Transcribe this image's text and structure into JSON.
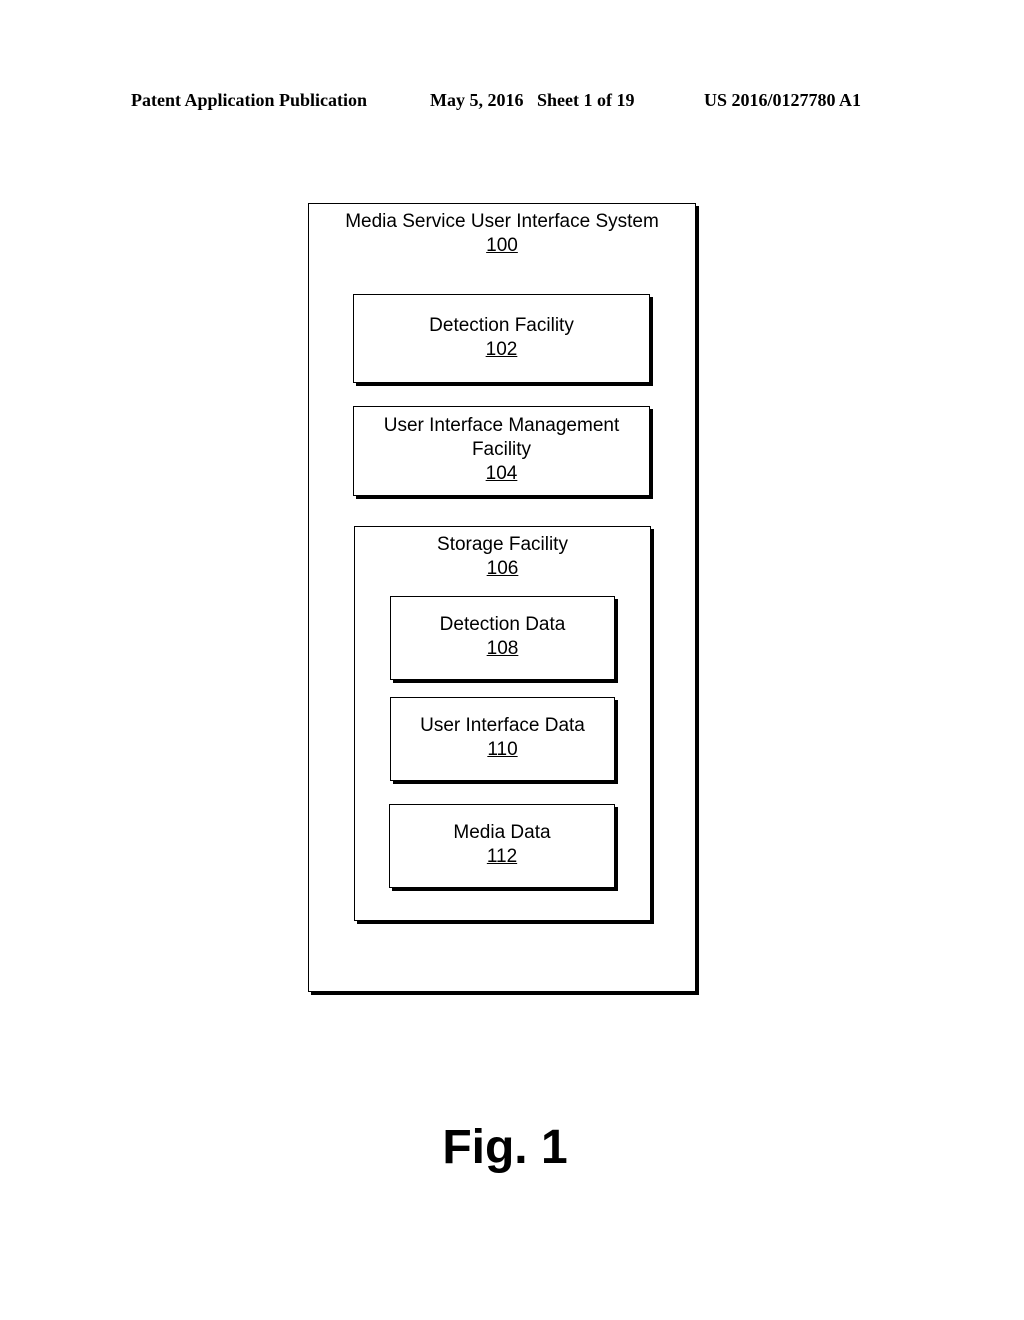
{
  "header": {
    "left": "Patent Application Publication",
    "date_sheet": "May 5, 2016   Sheet 1 of 19",
    "number": "US 2016/0127780 A1"
  },
  "diagram": {
    "system": {
      "label": "Media Service User Interface System",
      "ref": "100"
    },
    "detection_facility": {
      "label": "Detection Facility",
      "ref": "102"
    },
    "ui_management_facility": {
      "label_line1": "User Interface Management",
      "label_line2": "Facility",
      "ref": "104"
    },
    "storage_facility": {
      "label": "Storage Facility",
      "ref": "106"
    },
    "detection_data": {
      "label": "Detection Data",
      "ref": "108"
    },
    "ui_data": {
      "label": "User Interface Data",
      "ref": "110"
    },
    "media_data": {
      "label": "Media Data",
      "ref": "112"
    }
  },
  "figure_label": "Fig. 1"
}
